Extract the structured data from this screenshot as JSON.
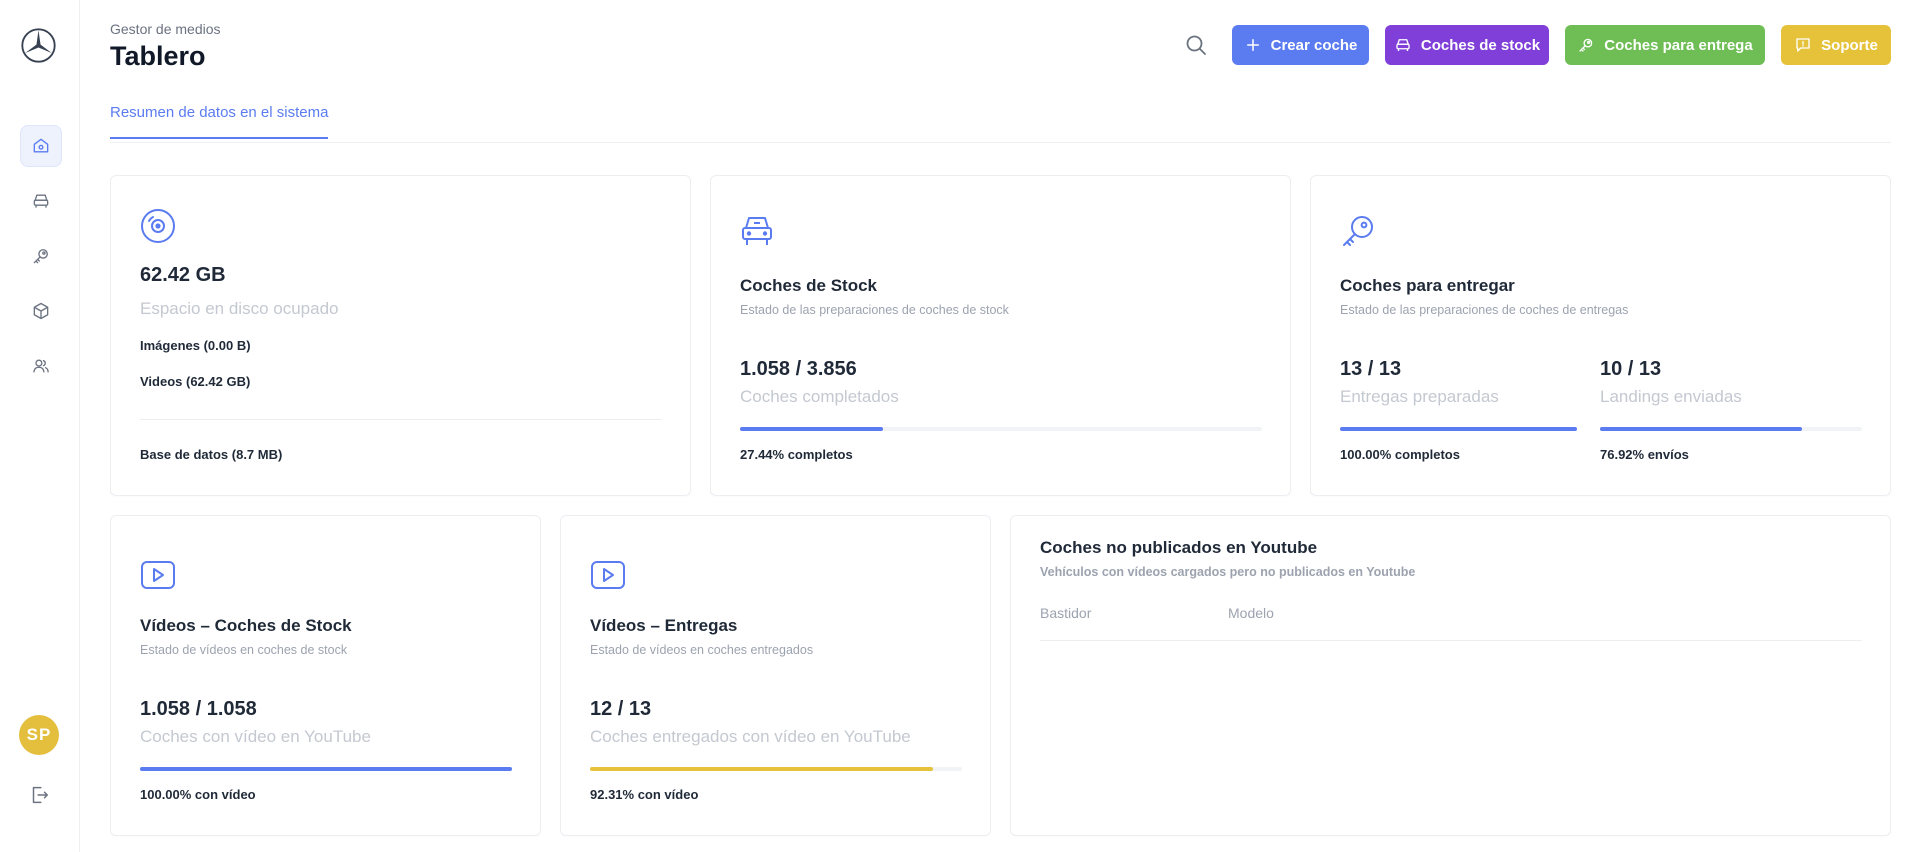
{
  "header": {
    "subtitle": "Gestor de medios",
    "title": "Tablero",
    "buttons": {
      "create": "Crear coche",
      "stock": "Coches de stock",
      "entrega": "Coches para entrega",
      "soporte": "Soporte"
    }
  },
  "tab": {
    "label": "Resumen de datos en el sistema"
  },
  "sidebar": {
    "items": [
      "home-icon",
      "car-icon",
      "key-icon",
      "box-icon",
      "users-icon"
    ],
    "avatar": "SP"
  },
  "disk": {
    "value": "62.42 GB",
    "label": "Espacio en disco ocupado",
    "images": "Imágenes (0.00 B)",
    "videos": "Videos (62.42 GB)",
    "database": "Base de datos (8.7 MB)"
  },
  "stock": {
    "title": "Coches de Stock",
    "desc": "Estado de las preparaciones de coches de stock",
    "value": "1.058 / 3.856",
    "label": "Coches completados",
    "progress": 0.2744,
    "pct": "27.44% completos"
  },
  "entregar": {
    "title": "Coches para entregar",
    "desc": "Estado de las preparaciones de coches de entregas",
    "left": {
      "value": "13 / 13",
      "label": "Entregas preparadas",
      "progress": 1.0,
      "pct": "100.00% completos"
    },
    "right": {
      "value": "10 / 13",
      "label": "Landings enviadas",
      "progress": 0.7692,
      "pct": "76.92% envíos"
    }
  },
  "videos_stock": {
    "title": "Vídeos – Coches de Stock",
    "desc": "Estado de vídeos en coches de stock",
    "value": "1.058 / 1.058",
    "label": "Coches con vídeo en YouTube",
    "progress": 1.0,
    "pct": "100.00% con vídeo",
    "color": "#5b7cf0"
  },
  "videos_entregas": {
    "title": "Vídeos – Entregas",
    "desc": "Estado de vídeos en coches entregados",
    "value": "12 / 13",
    "label": "Coches entregados con vídeo en YouTube",
    "progress": 0.9231,
    "pct": "92.31% con vídeo",
    "color": "#e6c23b"
  },
  "unpublished": {
    "title": "Coches no publicados en Youtube",
    "desc": "Vehículos con vídeos cargados pero no publicados en Youtube",
    "columns": [
      "Bastidor",
      "Modelo"
    ]
  }
}
